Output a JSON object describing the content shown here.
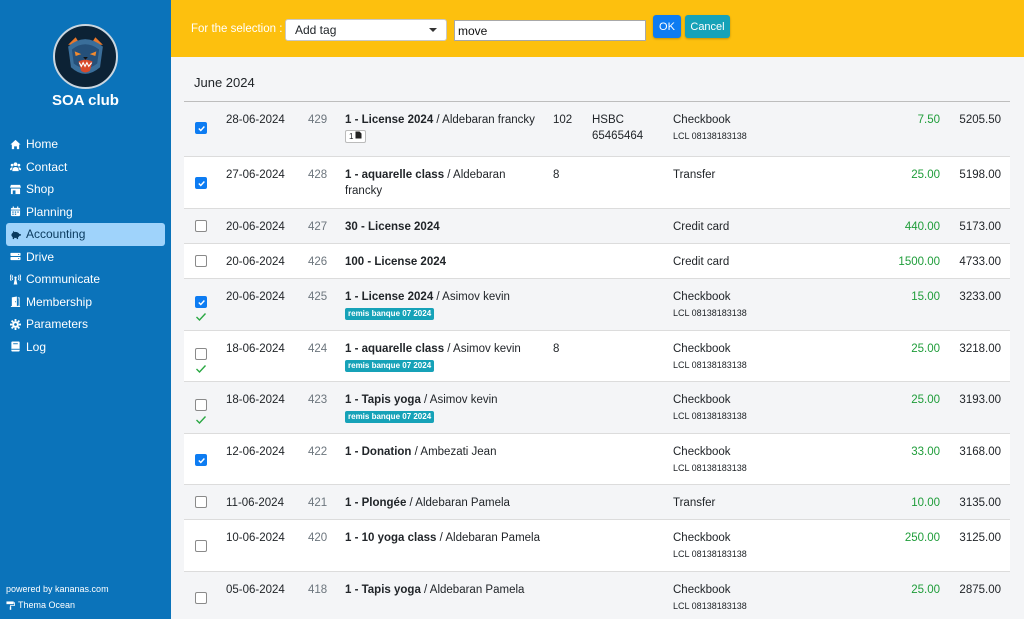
{
  "sidebar": {
    "club_name": "SOA club",
    "items": [
      {
        "label": "Home",
        "icon": "home-icon",
        "active": false
      },
      {
        "label": "Contact",
        "icon": "users-icon",
        "active": false
      },
      {
        "label": "Shop",
        "icon": "shop-icon",
        "active": false
      },
      {
        "label": "Planning",
        "icon": "calendar-icon",
        "active": false
      },
      {
        "label": "Accounting",
        "icon": "piggy-bank-icon",
        "active": true
      },
      {
        "label": "Drive",
        "icon": "drive-icon",
        "active": false
      },
      {
        "label": "Communicate",
        "icon": "broadcast-icon",
        "active": false
      },
      {
        "label": "Membership",
        "icon": "door-icon",
        "active": false
      },
      {
        "label": "Parameters",
        "icon": "gear-icon",
        "active": false
      },
      {
        "label": "Log",
        "icon": "book-icon",
        "active": false
      }
    ],
    "powered_by": "powered by kananas.com",
    "theme": "Thema Ocean"
  },
  "topbar": {
    "selection_label": "For the selection :",
    "action_selected": "Add tag",
    "input_value": "move",
    "ok_label": "OK",
    "cancel_label": "Cancel"
  },
  "main": {
    "month_title": "June 2024",
    "rows": [
      {
        "checked": true,
        "verified": false,
        "date": "28-06-2024",
        "num": "429",
        "label_bold": "1 - License 2024",
        "label_rest": " / Aldebaran francky",
        "doc_count": "1",
        "tag": "",
        "qty": "102",
        "bank": "HSBC 65465464",
        "method": "Checkbook",
        "method_sub": "LCL 08138183138",
        "amount": "7.50",
        "balance": "5205.50"
      },
      {
        "checked": true,
        "verified": false,
        "date": "27-06-2024",
        "num": "428",
        "label_bold": "1 - aquarelle class",
        "label_rest": " / Aldebaran francky",
        "doc_count": "",
        "tag": "",
        "qty": "8",
        "bank": "",
        "method": "Transfer",
        "method_sub": "",
        "amount": "25.00",
        "balance": "5198.00"
      },
      {
        "checked": false,
        "verified": false,
        "date": "20-06-2024",
        "num": "427",
        "label_bold": "30 - License 2024",
        "label_rest": "",
        "doc_count": "",
        "tag": "",
        "qty": "",
        "bank": "",
        "method": "Credit card",
        "method_sub": "",
        "amount": "440.00",
        "balance": "5173.00"
      },
      {
        "checked": false,
        "verified": false,
        "date": "20-06-2024",
        "num": "426",
        "label_bold": "100 - License 2024",
        "label_rest": "",
        "doc_count": "",
        "tag": "",
        "qty": "",
        "bank": "",
        "method": "Credit card",
        "method_sub": "",
        "amount": "1500.00",
        "balance": "4733.00"
      },
      {
        "checked": true,
        "verified": true,
        "date": "20-06-2024",
        "num": "425",
        "label_bold": "1 - License 2024",
        "label_rest": " / Asimov kevin",
        "doc_count": "",
        "tag": "remis banque 07 2024",
        "qty": "",
        "bank": "",
        "method": "Checkbook",
        "method_sub": "LCL 08138183138",
        "amount": "15.00",
        "balance": "3233.00"
      },
      {
        "checked": false,
        "verified": true,
        "date": "18-06-2024",
        "num": "424",
        "label_bold": "1 - aquarelle class",
        "label_rest": " / Asimov kevin",
        "doc_count": "",
        "tag": "remis banque 07 2024",
        "qty": "8",
        "bank": "",
        "method": "Checkbook",
        "method_sub": "LCL 08138183138",
        "amount": "25.00",
        "balance": "3218.00"
      },
      {
        "checked": false,
        "verified": true,
        "date": "18-06-2024",
        "num": "423",
        "label_bold": "1 - Tapis yoga",
        "label_rest": " / Asimov kevin",
        "doc_count": "",
        "tag": "remis banque 07 2024",
        "qty": "",
        "bank": "",
        "method": "Checkbook",
        "method_sub": "LCL 08138183138",
        "amount": "25.00",
        "balance": "3193.00"
      },
      {
        "checked": true,
        "verified": false,
        "date": "12-06-2024",
        "num": "422",
        "label_bold": "1 - Donation",
        "label_rest": " / Ambezati Jean",
        "doc_count": "",
        "tag": "",
        "qty": "",
        "bank": "",
        "method": "Checkbook",
        "method_sub": "LCL 08138183138",
        "amount": "33.00",
        "balance": "3168.00"
      },
      {
        "checked": false,
        "verified": false,
        "date": "11-06-2024",
        "num": "421",
        "label_bold": "1 - Plongée",
        "label_rest": " / Aldebaran Pamela",
        "doc_count": "",
        "tag": "",
        "qty": "",
        "bank": "",
        "method": "Transfer",
        "method_sub": "",
        "amount": "10.00",
        "balance": "3135.00"
      },
      {
        "checked": false,
        "verified": false,
        "date": "10-06-2024",
        "num": "420",
        "label_bold": "1 - 10 yoga class",
        "label_rest": " / Aldebaran Pamela",
        "doc_count": "",
        "tag": "",
        "qty": "",
        "bank": "",
        "method": "Checkbook",
        "method_sub": "LCL 08138183138",
        "amount": "250.00",
        "balance": "3125.00"
      },
      {
        "checked": false,
        "verified": false,
        "date": "05-06-2024",
        "num": "418",
        "label_bold": "1 - Tapis yoga",
        "label_rest": " / Aldebaran Pamela",
        "doc_count": "",
        "tag": "",
        "qty": "",
        "bank": "",
        "method": "Checkbook",
        "method_sub": "LCL 08138183138",
        "amount": "25.00",
        "balance": "2875.00"
      }
    ]
  },
  "colors": {
    "sidebar_bg": "#0b73ba",
    "topbar_bg": "#fdc00e",
    "accent_blue": "#0d7cf2",
    "tag_teal": "#16a2b8",
    "amount_green": "#1f9d3a"
  }
}
